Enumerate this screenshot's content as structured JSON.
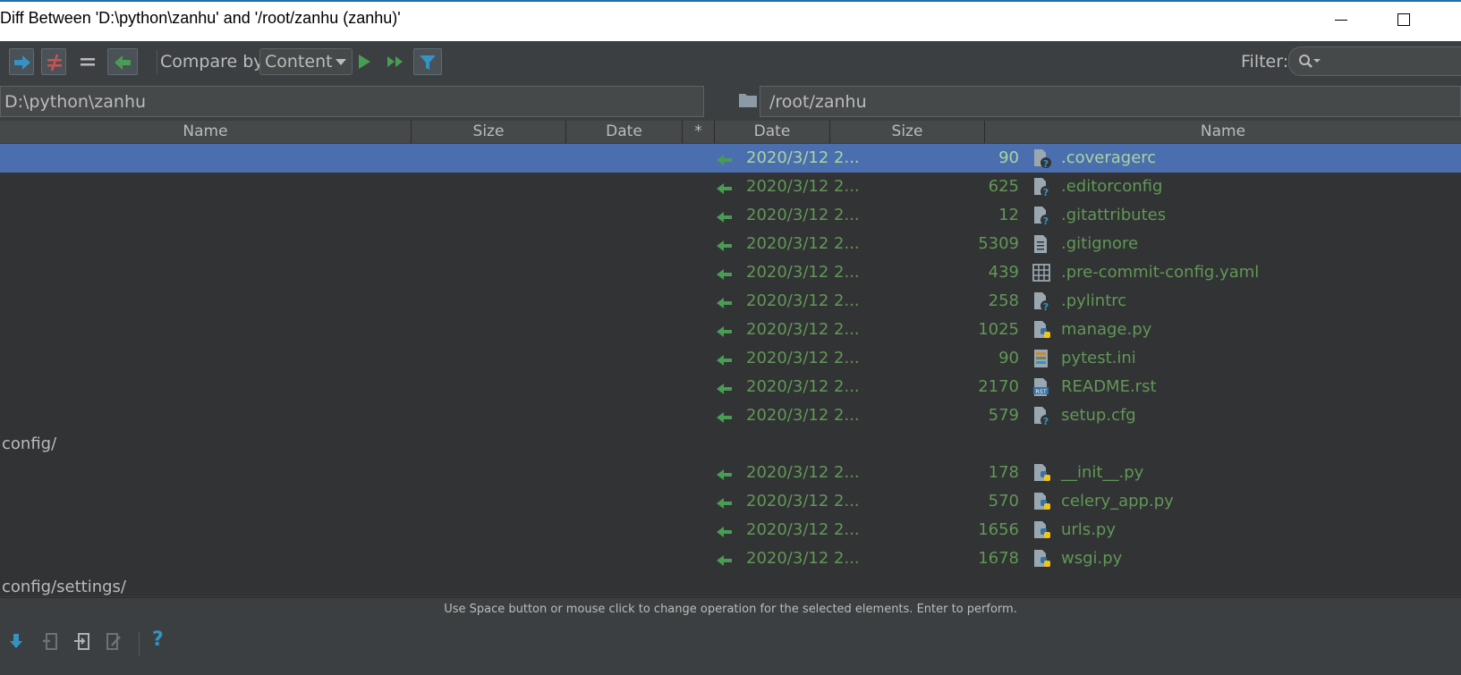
{
  "window": {
    "title": "Diff Between 'D:\\python\\zanhu' and '/root/zanhu (zanhu)'"
  },
  "toolbar": {
    "compare_label": "Compare by:",
    "compare_value": "Content",
    "filter_label": "Filter:",
    "accent_colors": {
      "blue": "#3592c4",
      "red": "#c75450",
      "green": "#499c54",
      "selection": "#4b6eaf"
    }
  },
  "paths": {
    "left": "D:\\python\\zanhu",
    "right": "/root/zanhu"
  },
  "columns": {
    "left_name": "Name",
    "left_size": "Size",
    "left_date": "Date",
    "star": "*",
    "right_date": "Date",
    "right_size": "Size",
    "right_name": "Name"
  },
  "files_root": [
    {
      "date": "2020/3/12 2...",
      "size": "90",
      "name": ".coveragerc",
      "icon": "unknown-file-icon",
      "selected": true
    },
    {
      "date": "2020/3/12 2...",
      "size": "625",
      "name": ".editorconfig",
      "icon": "unknown-file-icon"
    },
    {
      "date": "2020/3/12 2...",
      "size": "12",
      "name": ".gitattributes",
      "icon": "unknown-file-icon"
    },
    {
      "date": "2020/3/12 2...",
      "size": "5309",
      "name": ".gitignore",
      "icon": "text-file-icon"
    },
    {
      "date": "2020/3/12 2...",
      "size": "439",
      "name": ".pre-commit-config.yaml",
      "icon": "yaml-file-icon"
    },
    {
      "date": "2020/3/12 2...",
      "size": "258",
      "name": ".pylintrc",
      "icon": "unknown-file-icon"
    },
    {
      "date": "2020/3/12 2...",
      "size": "1025",
      "name": "manage.py",
      "icon": "python-file-icon"
    },
    {
      "date": "2020/3/12 2...",
      "size": "90",
      "name": "pytest.ini",
      "icon": "ini-file-icon"
    },
    {
      "date": "2020/3/12 2...",
      "size": "2170",
      "name": "README.rst",
      "icon": "rst-file-icon"
    },
    {
      "date": "2020/3/12 2...",
      "size": "579",
      "name": "setup.cfg",
      "icon": "unknown-file-icon"
    }
  ],
  "dir_config": "config/",
  "files_config": [
    {
      "date": "2020/3/12 2...",
      "size": "178",
      "name": "__init__.py",
      "icon": "python-file-icon"
    },
    {
      "date": "2020/3/12 2...",
      "size": "570",
      "name": "celery_app.py",
      "icon": "python-file-icon"
    },
    {
      "date": "2020/3/12 2...",
      "size": "1656",
      "name": "urls.py",
      "icon": "python-file-icon"
    },
    {
      "date": "2020/3/12 2...",
      "size": "1678",
      "name": "wsgi.py",
      "icon": "python-file-icon"
    }
  ],
  "dir_settings": "config/settings/",
  "hint": "Use Space button or mouse click to change operation for the selected elements. Enter to perform.",
  "bottom_help": "?"
}
